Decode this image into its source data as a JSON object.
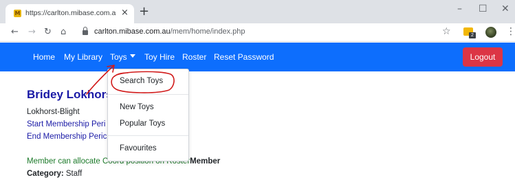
{
  "browser": {
    "tab_title": "https://carlton.mibase.com.au/m",
    "favicon_letter": "M",
    "close_glyph": "×",
    "newtab_glyph": "+",
    "window": {
      "minimize": "–",
      "maximize": "☐",
      "close": "✕"
    },
    "nav": {
      "back": "←",
      "forward": "→",
      "reload": "↻",
      "home": "⌂"
    },
    "url_host": "carlton.mibase.com.au",
    "url_path": "/mem/home/index.php",
    "star_glyph": "☆",
    "menu_glyph": "⋮",
    "extension_badge": "2"
  },
  "navbar": {
    "color": "#0d6efd",
    "links": [
      "Home",
      "My Library",
      "Toys",
      "Toy Hire",
      "Roster",
      "Reset Password"
    ],
    "logout_label": "Logout",
    "logout_color": "#dc3545"
  },
  "dropdown": {
    "items": [
      "Search Toys",
      "New Toys",
      "Popular Toys",
      "Favourites"
    ]
  },
  "member": {
    "name": "Bridey Lokhors",
    "surname_line": "Lokhorst-Blight",
    "start_link": "Start Membership Peri",
    "end_link": "End Membership Peric",
    "coord_text": "Member can allocate Coord position on Roster",
    "coord_bold": "Member",
    "category_label": "Category:",
    "category_value": " Staff"
  },
  "annotation_color": "#d11a1a"
}
